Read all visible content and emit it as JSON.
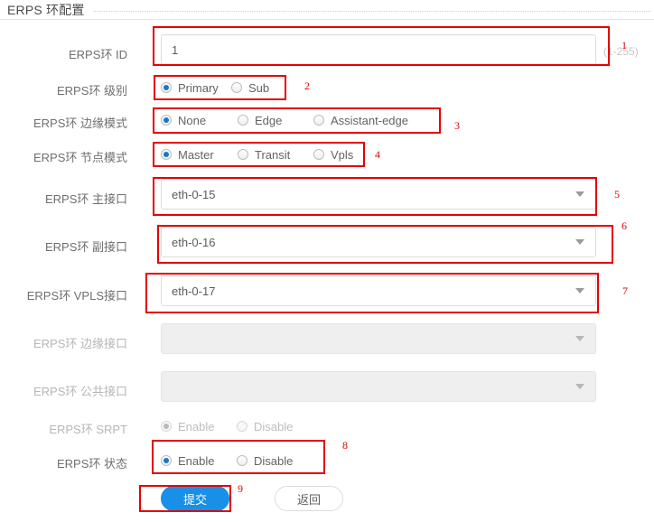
{
  "header": {
    "title": "ERPS 环配置"
  },
  "form": {
    "rows": [
      {
        "id": "ring-id",
        "label": "ERPS环 ID",
        "type": "text",
        "value": "1",
        "hint": "(1-255)",
        "disabled": false
      },
      {
        "id": "ring-level",
        "label": "ERPS环 级别",
        "type": "radio",
        "disabled": false,
        "options": [
          {
            "label": "Primary",
            "checked": true
          },
          {
            "label": "Sub",
            "checked": false
          }
        ]
      },
      {
        "id": "edge-mode",
        "label": "ERPS环 边缘模式",
        "type": "radio",
        "disabled": false,
        "options": [
          {
            "label": "None",
            "checked": true
          },
          {
            "label": "Edge",
            "checked": false
          },
          {
            "label": "Assistant-edge",
            "checked": false
          }
        ]
      },
      {
        "id": "node-mode",
        "label": "ERPS环 节点模式",
        "type": "radio",
        "disabled": false,
        "options": [
          {
            "label": "Master",
            "checked": true
          },
          {
            "label": "Transit",
            "checked": false
          },
          {
            "label": "Vpls",
            "checked": false
          }
        ]
      },
      {
        "id": "primary-port",
        "label": "ERPS环 主接口",
        "type": "select",
        "value": "eth-0-15",
        "disabled": false
      },
      {
        "id": "secondary-port",
        "label": "ERPS环 副接口",
        "type": "select",
        "value": "eth-0-16",
        "disabled": false
      },
      {
        "id": "vpls-port",
        "label": "ERPS环 VPLS接口",
        "type": "select",
        "value": "eth-0-17",
        "disabled": false
      },
      {
        "id": "edge-port",
        "label": "ERPS环 边缘接口",
        "type": "select",
        "value": "",
        "disabled": true
      },
      {
        "id": "common-port",
        "label": "ERPS环 公共接口",
        "type": "select",
        "value": "",
        "disabled": true
      },
      {
        "id": "srpt",
        "label": "ERPS环 SRPT",
        "type": "radio",
        "disabled": true,
        "options": [
          {
            "label": "Enable",
            "checked": true
          },
          {
            "label": "Disable",
            "checked": false
          }
        ]
      },
      {
        "id": "state",
        "label": "ERPS环 状态",
        "type": "radio",
        "disabled": false,
        "options": [
          {
            "label": "Enable",
            "checked": true
          },
          {
            "label": "Disable",
            "checked": false
          }
        ]
      }
    ]
  },
  "buttons": {
    "submit": "提交",
    "back": "返回"
  },
  "annotations": {
    "numbers": [
      "1",
      "2",
      "3",
      "4",
      "5",
      "6",
      "7",
      "8",
      "9"
    ]
  }
}
